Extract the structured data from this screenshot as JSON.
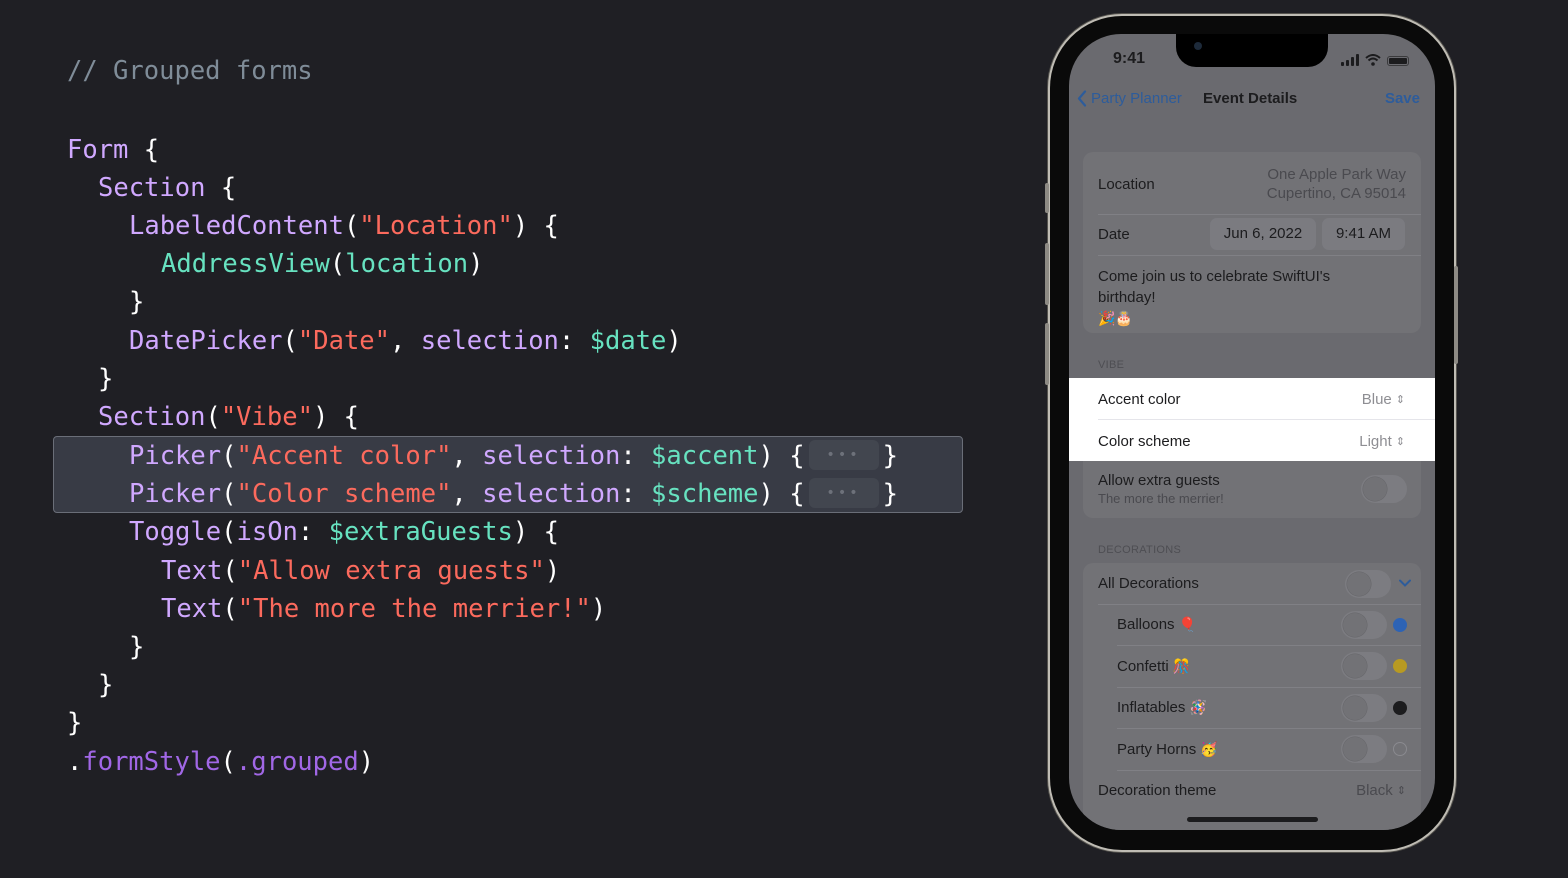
{
  "code": {
    "comment": "// Grouped forms",
    "lines": {
      "l1_kw": "Form",
      "l1_rest": " {",
      "l2_kw": "Section",
      "l2_rest": " {",
      "l3_kw": "LabeledContent",
      "l3_p1": "(",
      "l3_str": "\"Location\"",
      "l3_p2": ") {",
      "l4_kw": "AddressView",
      "l4_p1": "(",
      "l4_var": "location",
      "l4_p2": ")",
      "l5": "}",
      "l6_kw": "DatePicker",
      "l6_p1": "(",
      "l6_str": "\"Date\"",
      "l6_p2": ", ",
      "l6_arg": "selection",
      "l6_p3": ": ",
      "l6_var": "$date",
      "l6_p4": ")",
      "l7": "}",
      "l8_kw": "Section",
      "l8_p1": "(",
      "l8_str": "\"Vibe\"",
      "l8_p2": ") {",
      "l9_kw": "Picker",
      "l9_p1": "(",
      "l9_str": "\"Accent color\"",
      "l9_p2": ", ",
      "l9_arg": "selection",
      "l9_p3": ": ",
      "l9_var": "$accent",
      "l9_p4": ") {",
      "l9_end": "}",
      "l10_kw": "Picker",
      "l10_p1": "(",
      "l10_str": "\"Color scheme\"",
      "l10_p2": ", ",
      "l10_arg": "selection",
      "l10_p3": ": ",
      "l10_var": "$scheme",
      "l10_p4": ") {",
      "l10_end": "}",
      "l11_kw": "Toggle",
      "l11_p1": "(",
      "l11_arg": "isOn",
      "l11_p2": ": ",
      "l11_var": "$extraGuests",
      "l11_p3": ") {",
      "l12_kw": "Text",
      "l12_p1": "(",
      "l12_str": "\"Allow extra guests\"",
      "l12_p2": ")",
      "l13_kw": "Text",
      "l13_p1": "(",
      "l13_str": "\"The more the merrier!\"",
      "l13_p2": ")",
      "l14": "}",
      "l15": "}",
      "l16": "}",
      "l17_dot": ".",
      "l17_mod": "formStyle",
      "l17_p1": "(",
      "l17_arg": ".grouped",
      "l17_p2": ")"
    },
    "collapsed_placeholder": "•••"
  },
  "phone": {
    "status": {
      "time": "9:41"
    },
    "nav": {
      "back_label": "Party Planner",
      "title": "Event Details",
      "save_label": "Save"
    },
    "details": {
      "location_label": "Location",
      "address_line1": "One Apple Park Way",
      "address_line2": "Cupertino, CA 95014",
      "date_label": "Date",
      "date_value": "Jun 6, 2022",
      "time_value": "9:41 AM",
      "description_line1": "Come join us to celebrate SwiftUI's",
      "description_line2": "birthday!",
      "description_emoji": "🎉🎂"
    },
    "vibe": {
      "header": "VIBE",
      "accent_label": "Accent color",
      "accent_value": "Blue",
      "scheme_label": "Color scheme",
      "scheme_value": "Light",
      "extra_guests_label": "Allow extra guests",
      "extra_guests_sub": "The more the merrier!",
      "extra_guests_on": false
    },
    "decorations": {
      "header": "DECORATIONS",
      "all_label": "All Decorations",
      "items": [
        {
          "label": "Balloons",
          "emoji": "🎈",
          "color": "#2d63b5",
          "on": false
        },
        {
          "label": "Confetti",
          "emoji": "🎊",
          "color": "#b89a22",
          "on": false
        },
        {
          "label": "Inflatables",
          "emoji": "🪅",
          "color": "#1c1c1e",
          "on": false
        },
        {
          "label": "Party Horns",
          "emoji": "🥳",
          "color": "none",
          "on": false
        }
      ],
      "theme_label": "Decoration theme",
      "theme_value": "Black"
    },
    "chevron_updown": "⌃⌄"
  }
}
